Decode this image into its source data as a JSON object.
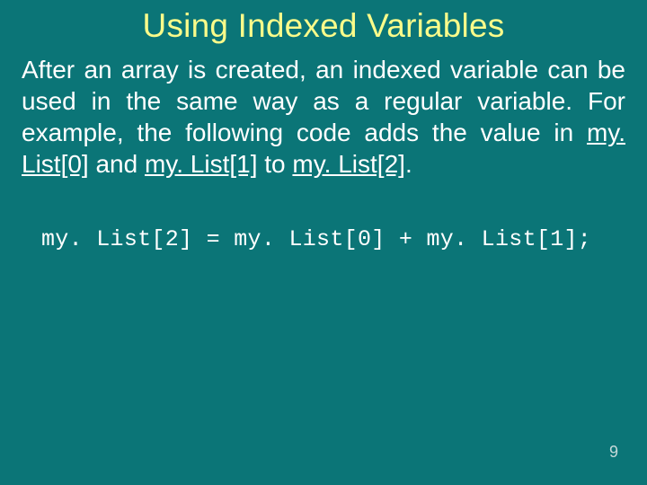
{
  "slide": {
    "title": "Using Indexed Variables",
    "body": {
      "pre": "After an array is created, an indexed variable can be used in the same way as a regular variable. For example, the following code adds the value in ",
      "ref0": "my. List[0]",
      "mid1": " and ",
      "ref1": "my. List[1]",
      "mid2": " to ",
      "ref2": "my. List[2]",
      "end": "."
    },
    "code": "my. List[2] = my. List[0] + my. List[1];",
    "page_number": "9"
  }
}
